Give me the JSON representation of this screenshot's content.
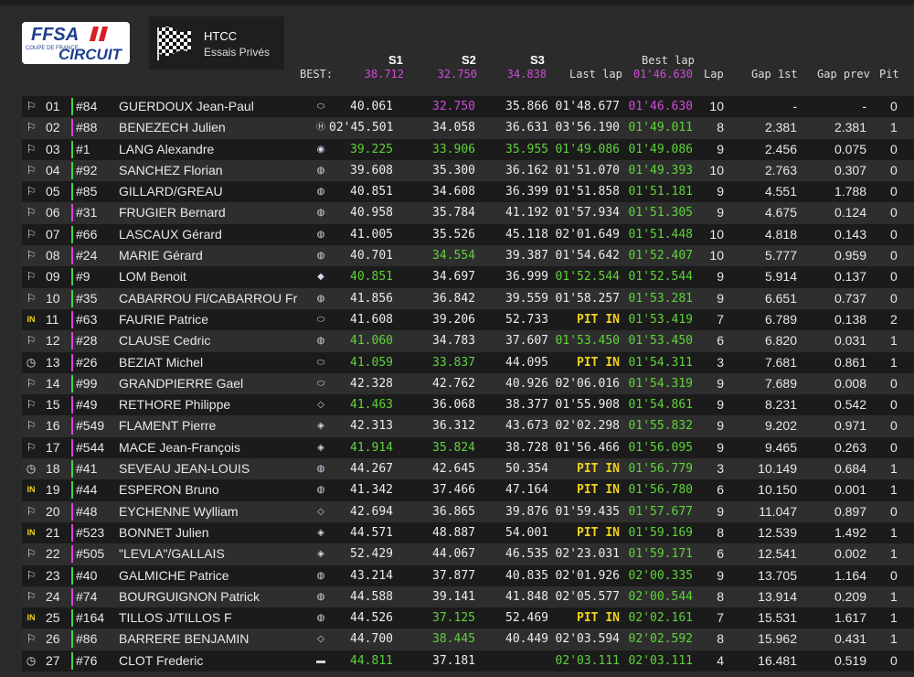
{
  "logo": {
    "top": "FFSA",
    "small": "COUPE DE FRANCE",
    "bottom": "CIRCUIT"
  },
  "session": {
    "title": "HTCC",
    "subtitle": "Essais Privés",
    "flag_icon": "checkered-flag-icon"
  },
  "columns": {
    "s1": "S1",
    "s2": "S2",
    "s3": "S3",
    "best_label": "BEST:",
    "last_lap": "Last lap",
    "best_lap": "Best lap",
    "lap": "Lap",
    "gap_first": "Gap 1st",
    "gap_prev": "Gap prev",
    "pit": "Pit"
  },
  "best": {
    "s1": "38.712",
    "s2": "32.750",
    "s3": "34.838",
    "lap": "01'46.630"
  },
  "colors": {
    "purple": "#d04ad8",
    "green": "#5fd33a",
    "yellow": "#f0d21c",
    "stripe_green": "#3fd44a",
    "stripe_magenta": "#e040e0"
  },
  "rows": [
    {
      "pos": "01",
      "num": "#84",
      "name": "GUERDOUX Jean-Paul",
      "status": "flag",
      "brand": "ford",
      "stripe": "green",
      "s1": "40.061",
      "s1c": "white",
      "s2": "32.750",
      "s2c": "purple",
      "s3": "35.866",
      "s3c": "white",
      "last": "01'48.677",
      "lastc": "white",
      "best": "01'46.630",
      "bestc": "purple",
      "lap": "10",
      "gap1": "-",
      "gapp": "-",
      "pit": "0"
    },
    {
      "pos": "02",
      "num": "#88",
      "name": "BENEZECH Julien",
      "status": "flag",
      "brand": "honda",
      "stripe": "magenta",
      "s1": "02'45.501",
      "s1c": "white",
      "s2": "34.058",
      "s2c": "white",
      "s3": "36.631",
      "s3c": "white",
      "last": "03'56.190",
      "lastc": "white",
      "best": "01'49.011",
      "bestc": "green",
      "lap": "8",
      "gap1": "2.381",
      "gapp": "2.381",
      "pit": "1"
    },
    {
      "pos": "03",
      "num": "#1",
      "name": "LANG Alexandre",
      "status": "flag",
      "brand": "vw",
      "stripe": "green",
      "s1": "39.225",
      "s1c": "green",
      "s2": "33.906",
      "s2c": "green",
      "s3": "35.955",
      "s3c": "green",
      "last": "01'49.086",
      "lastc": "green",
      "best": "01'49.086",
      "bestc": "green",
      "lap": "9",
      "gap1": "2.456",
      "gapp": "0.075",
      "pit": "0"
    },
    {
      "pos": "04",
      "num": "#92",
      "name": "SANCHEZ Florian",
      "status": "flag",
      "brand": "bmw",
      "stripe": "green",
      "s1": "39.608",
      "s1c": "white",
      "s2": "35.300",
      "s2c": "white",
      "s3": "36.162",
      "s3c": "white",
      "last": "01'51.070",
      "lastc": "white",
      "best": "01'49.393",
      "bestc": "green",
      "lap": "10",
      "gap1": "2.763",
      "gapp": "0.307",
      "pit": "0"
    },
    {
      "pos": "05",
      "num": "#85",
      "name": "GILLARD/GREAU",
      "status": "flag",
      "brand": "bmw",
      "stripe": "green",
      "s1": "40.851",
      "s1c": "white",
      "s2": "34.608",
      "s2c": "white",
      "s3": "36.399",
      "s3c": "white",
      "last": "01'51.858",
      "lastc": "white",
      "best": "01'51.181",
      "bestc": "green",
      "lap": "9",
      "gap1": "4.551",
      "gapp": "1.788",
      "pit": "0"
    },
    {
      "pos": "06",
      "num": "#31",
      "name": "FRUGIER Bernard",
      "status": "flag",
      "brand": "bmw",
      "stripe": "magenta",
      "s1": "40.958",
      "s1c": "white",
      "s2": "35.784",
      "s2c": "white",
      "s3": "41.192",
      "s3c": "white",
      "last": "01'57.934",
      "lastc": "white",
      "best": "01'51.305",
      "bestc": "green",
      "lap": "9",
      "gap1": "4.675",
      "gapp": "0.124",
      "pit": "0"
    },
    {
      "pos": "07",
      "num": "#66",
      "name": "LASCAUX Gérard",
      "status": "flag",
      "brand": "bmw",
      "stripe": "green",
      "s1": "41.005",
      "s1c": "white",
      "s2": "35.526",
      "s2c": "white",
      "s3": "45.118",
      "s3c": "white",
      "last": "02'01.649",
      "lastc": "white",
      "best": "01'51.448",
      "bestc": "green",
      "lap": "10",
      "gap1": "4.818",
      "gapp": "0.143",
      "pit": "0"
    },
    {
      "pos": "08",
      "num": "#24",
      "name": "MARIE Gérard",
      "status": "flag",
      "brand": "bmw",
      "stripe": "magenta",
      "s1": "40.701",
      "s1c": "white",
      "s2": "34.554",
      "s2c": "green",
      "s3": "39.387",
      "s3c": "white",
      "last": "01'54.642",
      "lastc": "white",
      "best": "01'52.407",
      "bestc": "green",
      "lap": "10",
      "gap1": "5.777",
      "gapp": "0.959",
      "pit": "0"
    },
    {
      "pos": "09",
      "num": "#9",
      "name": "LOM Benoit",
      "status": "flag",
      "brand": "porsche",
      "stripe": "green",
      "s1": "40.851",
      "s1c": "green",
      "s2": "34.697",
      "s2c": "white",
      "s3": "36.999",
      "s3c": "white",
      "last": "01'52.544",
      "lastc": "green",
      "best": "01'52.544",
      "bestc": "green",
      "lap": "9",
      "gap1": "5.914",
      "gapp": "0.137",
      "pit": "0"
    },
    {
      "pos": "10",
      "num": "#35",
      "name": "CABARROU Fl/CABARROU Fr",
      "status": "flag",
      "brand": "bmw",
      "stripe": "green",
      "s1": "41.856",
      "s1c": "white",
      "s2": "36.842",
      "s2c": "white",
      "s3": "39.559",
      "s3c": "white",
      "last": "01'58.257",
      "lastc": "white",
      "best": "01'53.281",
      "bestc": "green",
      "lap": "9",
      "gap1": "6.651",
      "gapp": "0.737",
      "pit": "0"
    },
    {
      "pos": "11",
      "num": "#63",
      "name": "FAURIE Patrice",
      "status": "in",
      "brand": "ford",
      "stripe": "magenta",
      "s1": "41.608",
      "s1c": "white",
      "s2": "39.206",
      "s2c": "white",
      "s3": "52.733",
      "s3c": "white",
      "last": "PIT IN",
      "lastc": "yellow",
      "best": "01'53.419",
      "bestc": "green",
      "lap": "7",
      "gap1": "6.789",
      "gapp": "0.138",
      "pit": "2"
    },
    {
      "pos": "12",
      "num": "#28",
      "name": "CLAUSE Cedric",
      "status": "flag",
      "brand": "bmw",
      "stripe": "magenta",
      "s1": "41.060",
      "s1c": "green",
      "s2": "34.783",
      "s2c": "white",
      "s3": "37.607",
      "s3c": "white",
      "last": "01'53.450",
      "lastc": "green",
      "best": "01'53.450",
      "bestc": "green",
      "lap": "6",
      "gap1": "6.820",
      "gapp": "0.031",
      "pit": "1"
    },
    {
      "pos": "13",
      "num": "#26",
      "name": "BEZIAT Michel",
      "status": "clock",
      "brand": "ford",
      "stripe": "magenta",
      "s1": "41.059",
      "s1c": "green",
      "s2": "33.837",
      "s2c": "green",
      "s3": "44.095",
      "s3c": "white",
      "last": "PIT IN",
      "lastc": "yellow",
      "best": "01'54.311",
      "bestc": "green",
      "lap": "3",
      "gap1": "7.681",
      "gapp": "0.861",
      "pit": "1"
    },
    {
      "pos": "14",
      "num": "#99",
      "name": "GRANDPIERRE Gael",
      "status": "flag",
      "brand": "ford",
      "stripe": "green",
      "s1": "42.328",
      "s1c": "white",
      "s2": "42.762",
      "s2c": "white",
      "s3": "40.926",
      "s3c": "white",
      "last": "02'06.016",
      "lastc": "white",
      "best": "01'54.319",
      "bestc": "green",
      "lap": "9",
      "gap1": "7.689",
      "gapp": "0.008",
      "pit": "0"
    },
    {
      "pos": "15",
      "num": "#49",
      "name": "RETHORE Philippe",
      "status": "flag",
      "brand": "renault",
      "stripe": "magenta",
      "s1": "41.463",
      "s1c": "green",
      "s2": "36.068",
      "s2c": "white",
      "s3": "38.377",
      "s3c": "white",
      "last": "01'55.908",
      "lastc": "white",
      "best": "01'54.861",
      "bestc": "green",
      "lap": "9",
      "gap1": "8.231",
      "gapp": "0.542",
      "pit": "0"
    },
    {
      "pos": "16",
      "num": "#549",
      "name": "FLAMENT Pierre",
      "status": "flag",
      "brand": "peugeot",
      "stripe": "magenta",
      "s1": "42.313",
      "s1c": "white",
      "s2": "36.312",
      "s2c": "white",
      "s3": "43.673",
      "s3c": "white",
      "last": "02'02.298",
      "lastc": "white",
      "best": "01'55.832",
      "bestc": "green",
      "lap": "9",
      "gap1": "9.202",
      "gapp": "0.971",
      "pit": "0"
    },
    {
      "pos": "17",
      "num": "#544",
      "name": "MACE Jean-François",
      "status": "flag",
      "brand": "peugeot",
      "stripe": "magenta",
      "s1": "41.914",
      "s1c": "green",
      "s2": "35.824",
      "s2c": "green",
      "s3": "38.728",
      "s3c": "white",
      "last": "01'56.466",
      "lastc": "white",
      "best": "01'56.095",
      "bestc": "green",
      "lap": "9",
      "gap1": "9.465",
      "gapp": "0.263",
      "pit": "0"
    },
    {
      "pos": "18",
      "num": "#41",
      "name": "SEVEAU JEAN-LOUIS",
      "status": "clock",
      "brand": "bmw",
      "stripe": "green",
      "s1": "44.267",
      "s1c": "white",
      "s2": "42.645",
      "s2c": "white",
      "s3": "50.354",
      "s3c": "white",
      "last": "PIT IN",
      "lastc": "yellow",
      "best": "01'56.779",
      "bestc": "green",
      "lap": "3",
      "gap1": "10.149",
      "gapp": "0.684",
      "pit": "1"
    },
    {
      "pos": "19",
      "num": "#44",
      "name": "ESPERON Bruno",
      "status": "in",
      "brand": "bmw",
      "stripe": "green",
      "s1": "41.342",
      "s1c": "white",
      "s2": "37.466",
      "s2c": "white",
      "s3": "47.164",
      "s3c": "white",
      "last": "PIT IN",
      "lastc": "yellow",
      "best": "01'56.780",
      "bestc": "green",
      "lap": "6",
      "gap1": "10.150",
      "gapp": "0.001",
      "pit": "1"
    },
    {
      "pos": "20",
      "num": "#48",
      "name": "EYCHENNE Wylliam",
      "status": "flag",
      "brand": "renault",
      "stripe": "magenta",
      "s1": "42.694",
      "s1c": "white",
      "s2": "36.865",
      "s2c": "white",
      "s3": "39.876",
      "s3c": "white",
      "last": "01'59.435",
      "lastc": "white",
      "best": "01'57.677",
      "bestc": "green",
      "lap": "9",
      "gap1": "11.047",
      "gapp": "0.897",
      "pit": "0"
    },
    {
      "pos": "21",
      "num": "#523",
      "name": "BONNET Julien",
      "status": "in",
      "brand": "peugeot",
      "stripe": "magenta",
      "s1": "44.571",
      "s1c": "white",
      "s2": "48.887",
      "s2c": "white",
      "s3": "54.001",
      "s3c": "white",
      "last": "PIT IN",
      "lastc": "yellow",
      "best": "01'59.169",
      "bestc": "green",
      "lap": "8",
      "gap1": "12.539",
      "gapp": "1.492",
      "pit": "1"
    },
    {
      "pos": "22",
      "num": "#505",
      "name": "\"LEVLA\"/GALLAIS",
      "status": "flag",
      "brand": "peugeot",
      "stripe": "magenta",
      "s1": "52.429",
      "s1c": "white",
      "s2": "44.067",
      "s2c": "white",
      "s3": "46.535",
      "s3c": "white",
      "last": "02'23.031",
      "lastc": "white",
      "best": "01'59.171",
      "bestc": "green",
      "lap": "6",
      "gap1": "12.541",
      "gapp": "0.002",
      "pit": "1"
    },
    {
      "pos": "23",
      "num": "#40",
      "name": "GALMICHE Patrice",
      "status": "flag",
      "brand": "bmw",
      "stripe": "green",
      "s1": "43.214",
      "s1c": "white",
      "s2": "37.877",
      "s2c": "white",
      "s3": "40.835",
      "s3c": "white",
      "last": "02'01.926",
      "lastc": "white",
      "best": "02'00.335",
      "bestc": "green",
      "lap": "9",
      "gap1": "13.705",
      "gapp": "1.164",
      "pit": "0"
    },
    {
      "pos": "24",
      "num": "#74",
      "name": "BOURGUIGNON Patrick",
      "status": "flag",
      "brand": "bmw",
      "stripe": "magenta",
      "s1": "44.588",
      "s1c": "white",
      "s2": "39.141",
      "s2c": "white",
      "s3": "41.848",
      "s3c": "white",
      "last": "02'05.577",
      "lastc": "white",
      "best": "02'00.544",
      "bestc": "green",
      "lap": "8",
      "gap1": "13.914",
      "gapp": "0.209",
      "pit": "1"
    },
    {
      "pos": "25",
      "num": "#164",
      "name": "TILLOS J/TILLOS F",
      "status": "in",
      "brand": "bmw",
      "stripe": "green",
      "s1": "44.526",
      "s1c": "white",
      "s2": "37.125",
      "s2c": "green",
      "s3": "52.469",
      "s3c": "white",
      "last": "PIT IN",
      "lastc": "yellow",
      "best": "02'02.161",
      "bestc": "green",
      "lap": "7",
      "gap1": "15.531",
      "gapp": "1.617",
      "pit": "1"
    },
    {
      "pos": "26",
      "num": "#86",
      "name": "BARRERE BENJAMIN",
      "status": "flag",
      "brand": "renault",
      "stripe": "green",
      "s1": "44.700",
      "s1c": "white",
      "s2": "38.445",
      "s2c": "green",
      "s3": "40.449",
      "s3c": "white",
      "last": "02'03.594",
      "lastc": "white",
      "best": "02'02.592",
      "bestc": "green",
      "lap": "8",
      "gap1": "15.962",
      "gapp": "0.431",
      "pit": "1"
    },
    {
      "pos": "27",
      "num": "#76",
      "name": "CLOT Frederic",
      "status": "clock",
      "brand": "other",
      "stripe": "green",
      "s1": "44.811",
      "s1c": "green",
      "s2": "37.181",
      "s2c": "white",
      "s3": "",
      "s3c": "white",
      "last": "02'03.111",
      "lastc": "green",
      "best": "02'03.111",
      "bestc": "green",
      "lap": "4",
      "gap1": "16.481",
      "gapp": "0.519",
      "pit": "0"
    }
  ]
}
